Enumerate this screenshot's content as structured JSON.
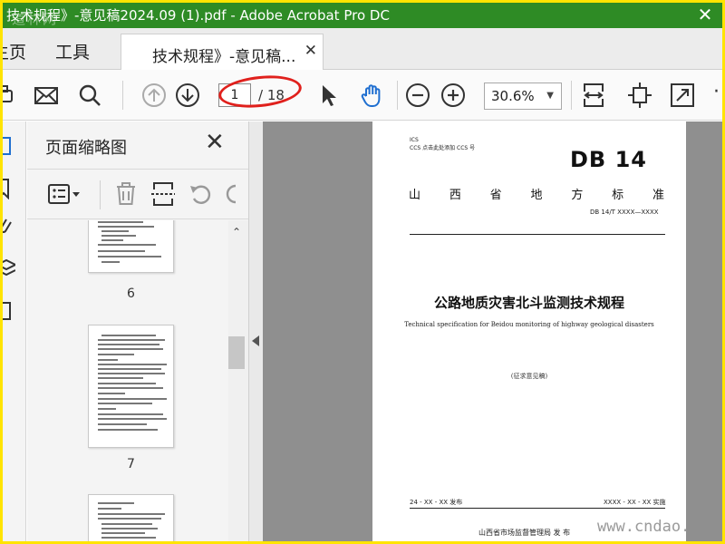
{
  "window": {
    "title": "技术规程》-意见稿2024.09 (1).pdf - Adobe Acrobat Pro DC",
    "title_watermark": "道林网",
    "close_glyph": "✕"
  },
  "tabs": {
    "home_label": "主页",
    "tools_label": "工具",
    "doc_label": "技术规程》-意见稿...",
    "close_glyph": "✕"
  },
  "toolbar": {
    "page_current": "1",
    "page_total": "/ 18",
    "zoom": "30.6%",
    "zoom_caret": "▼",
    "more": "·"
  },
  "panel": {
    "title": "页面缩略图",
    "close_glyph": "✕",
    "scroll_up": "⌃",
    "pages": [
      "6",
      "7"
    ]
  },
  "document": {
    "ics_line": "ICS",
    "ccs_line": "CCS 点击此处添加 CCS 号",
    "standard_mark": "DB 14",
    "province_chars": [
      "山",
      "西",
      "省",
      "地",
      "方",
      "标",
      "准"
    ],
    "code": "DB 14/T XXXX—XXXX",
    "title_cn": "公路地质灾害北斗监测技术规程",
    "title_en": "Technical specification for Beidou monitoring of highway geological disasters",
    "draft_note": "(征求意见稿)",
    "publish_left": "24 - XX - XX 发布",
    "publish_right": "XXXX - XX - XX 实施",
    "issuer": "山西省市场监督管理局    发 布"
  },
  "watermark": "www.cndao.",
  "colors": {
    "titlebar": "#2e8b25",
    "outer_border": "#ffe400",
    "annotation": "#e0201c",
    "hand_tool": "#1f6fd0"
  }
}
